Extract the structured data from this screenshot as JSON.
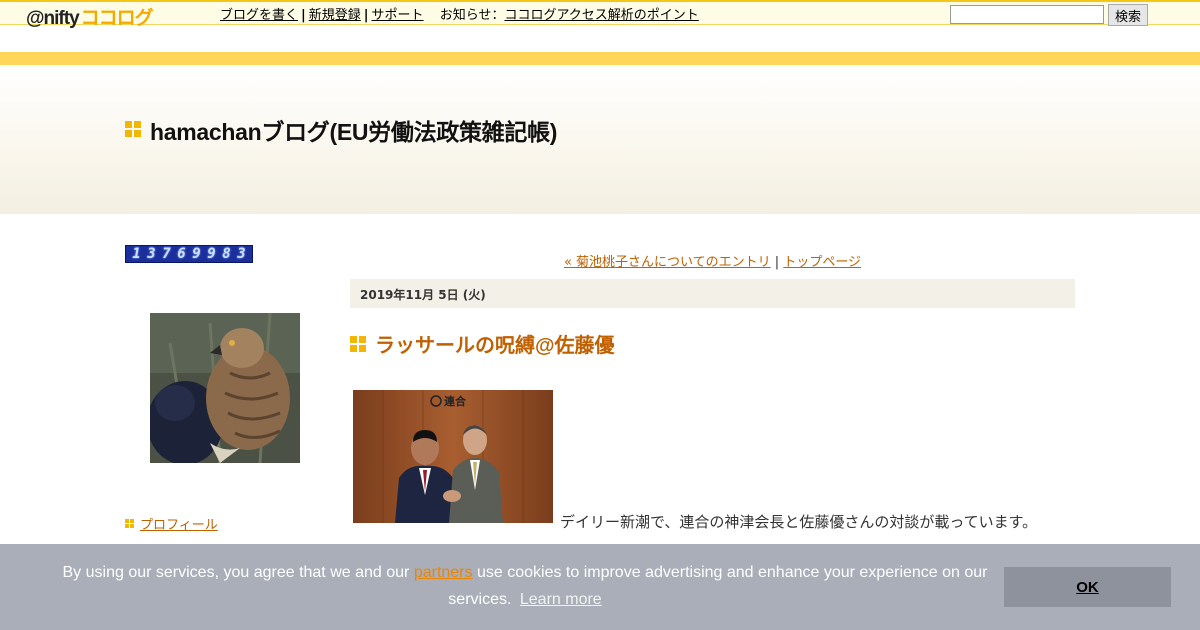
{
  "header": {
    "logo_prefix": "@nifty",
    "logo_brand": "ココログ",
    "links": [
      "ブログを書く",
      "新規登録",
      "サポート"
    ],
    "news_label": "お知らせ",
    "news_link": "ココログアクセス解析のポイント",
    "search_placeholder": "",
    "search_button": "検索"
  },
  "blog": {
    "title": "hamachanブログ(EU労働法政策雑記帳)"
  },
  "sidebar": {
    "counter_digits": [
      "1",
      "3",
      "7",
      "6",
      "9",
      "9",
      "8",
      "3"
    ],
    "profile_link": "プロフィール"
  },
  "entry": {
    "prev_link": "« 菊池桃子さんについてのエントリ",
    "nav_separator": "|",
    "top_link": "トップページ",
    "date": "2019年11月 5日 (火)",
    "title": "ラッサールの呪縛@佐藤優",
    "photo_sign_text": "連合",
    "body_first_line": "デイリー新潮で、連合の神津会長と佐藤優さんの対談が載っています。"
  },
  "cookie": {
    "text_before": "By using our services, you agree that we and our",
    "partners_link": "partners",
    "text_after": "use cookies to improve advertising and enhance your experience on our services.",
    "learn_more": "Learn more",
    "ok_button": "OK"
  },
  "colors": {
    "accent_orange": "#c06000",
    "brand_yellow": "#f2b705",
    "stripe_yellow": "#fdd65a",
    "cookie_bg": "#a9aeb8"
  }
}
